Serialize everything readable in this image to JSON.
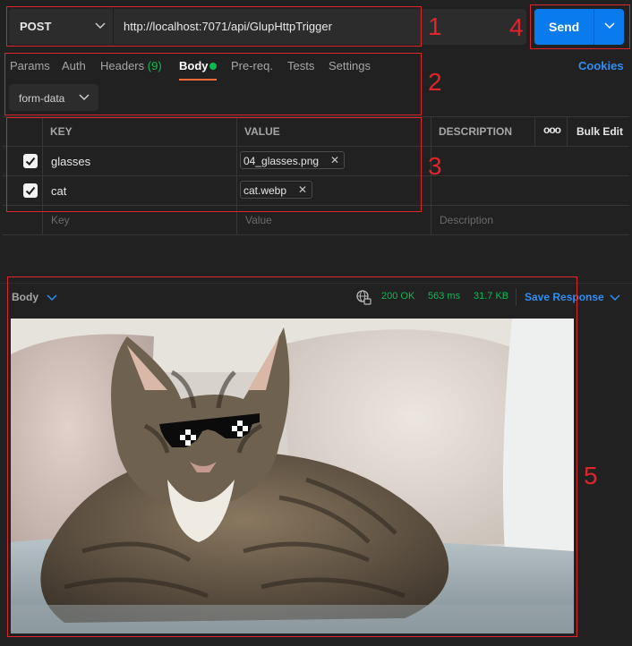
{
  "request": {
    "method": "POST",
    "url": "http://localhost:7071/api/GlupHttpTrigger",
    "send_label": "Send"
  },
  "tabs": [
    {
      "label": "Params"
    },
    {
      "label": "Auth"
    },
    {
      "label": "Headers (9)",
      "base": "Headers",
      "count": "(9)"
    },
    {
      "label": "Body",
      "active": true
    },
    {
      "label": "Pre-req."
    },
    {
      "label": "Tests"
    },
    {
      "label": "Settings"
    }
  ],
  "cookies_label": "Cookies",
  "body_mode": "form-data",
  "table": {
    "headers": {
      "key": "KEY",
      "value": "VALUE",
      "description": "DESCRIPTION",
      "more": "ooo",
      "bulk_edit": "Bulk Edit"
    },
    "rows": [
      {
        "key": "glasses",
        "value": "04_glasses.png",
        "checked": true
      },
      {
        "key": "cat",
        "value": "cat.webp",
        "checked": true
      }
    ],
    "placeholders": {
      "key": "Key",
      "value": "Value",
      "description": "Description"
    }
  },
  "response": {
    "view_label": "Body",
    "status": "200 OK",
    "time": "563 ms",
    "size": "31.7 KB",
    "save_label": "Save Response"
  },
  "annotations": [
    "1",
    "2",
    "3",
    "4",
    "5"
  ],
  "colors": {
    "send_blue": "#097bed",
    "link_blue": "#2f8ef4",
    "status_green": "#0cbb52",
    "tab_accent": "#ff6c37",
    "annotation_red": "#e0242b"
  }
}
